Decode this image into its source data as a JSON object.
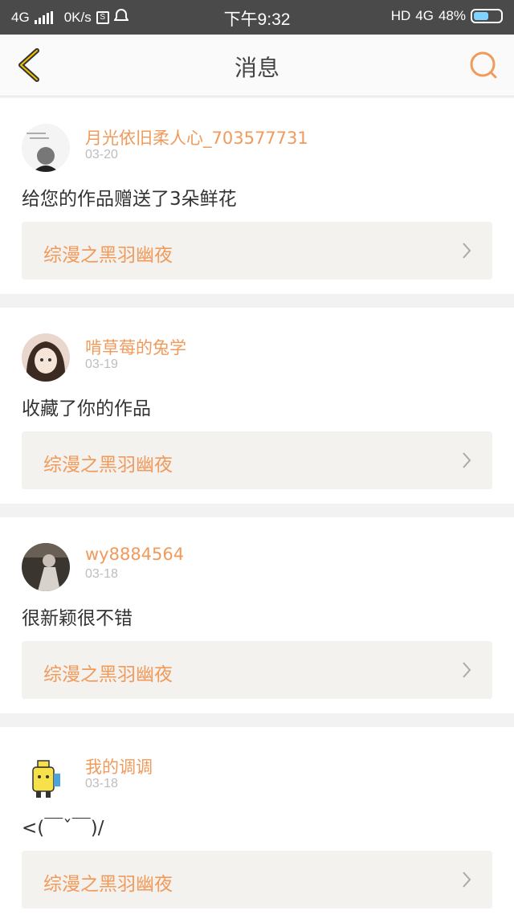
{
  "status_bar": {
    "network_left": "4G",
    "speed": "0K/s",
    "sim_icon_letter": "S",
    "time": "下午9:32",
    "hd": "HD",
    "network_right": "4G",
    "battery": "48%"
  },
  "header": {
    "title": "消息",
    "back_icon": "chevron-left-icon",
    "search_icon": "search-icon"
  },
  "colors": {
    "accent": "#f09a5b",
    "status_bar_bg": "#4a4a4a",
    "work_bg": "#f4f2ee"
  },
  "messages": [
    {
      "name": "月光依旧柔人心_703577731",
      "date": "03-20",
      "text": "给您的作品赠送了3朵鲜花",
      "work_title": "综漫之黑羽幽夜"
    },
    {
      "name": "啃草莓的兔学",
      "date": "03-19",
      "text": "收藏了你的作品",
      "work_title": "综漫之黑羽幽夜"
    },
    {
      "name": "wy8884564",
      "date": "03-18",
      "text": "很新颖很不错",
      "work_title": "综漫之黑羽幽夜"
    },
    {
      "name": "我的调调",
      "date": "03-18",
      "text": "<(￣ˇ￣)/",
      "work_title": "综漫之黑羽幽夜"
    }
  ]
}
